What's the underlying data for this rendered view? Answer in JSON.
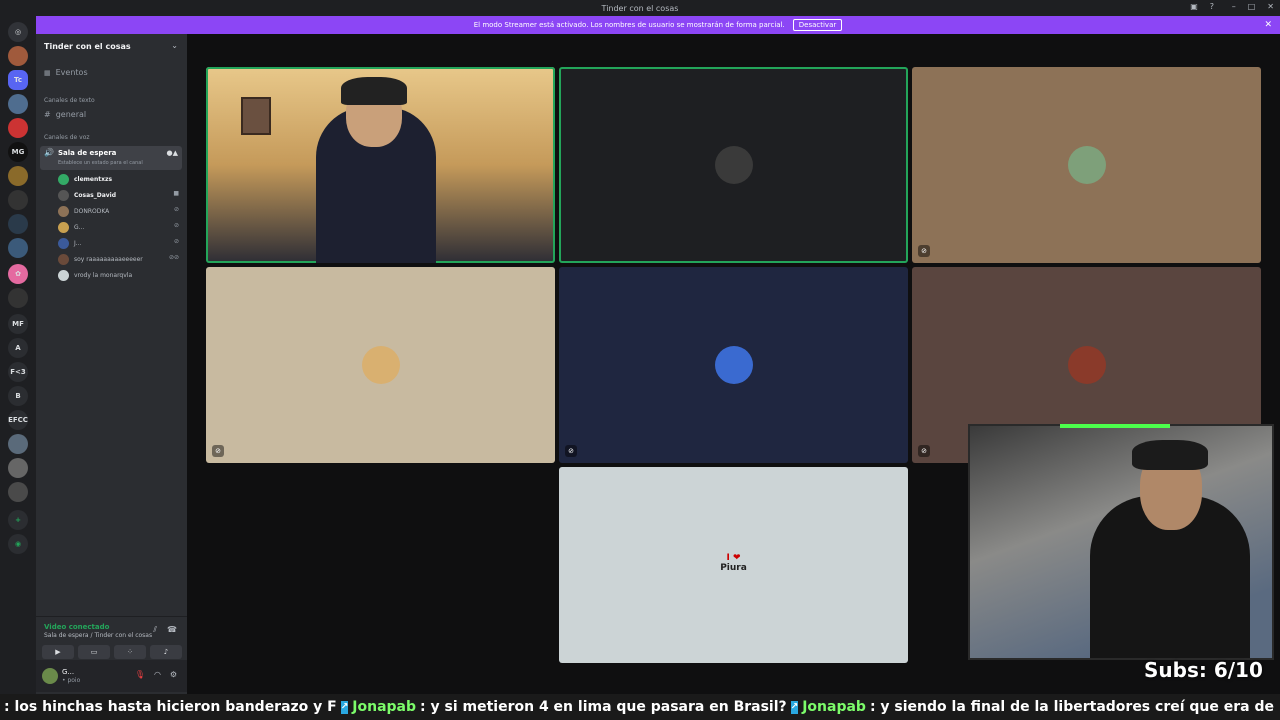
{
  "window": {
    "title": "Tinder con el cosas",
    "controls": [
      "–",
      "□",
      "✕"
    ]
  },
  "streamer_banner": {
    "text": "El modo Streamer está activado. Los nombres de usuario se mostrarán de forma parcial.",
    "button": "Desactivar",
    "close": "✕"
  },
  "guilds": [
    "MG",
    "MF",
    "A",
    "F<3",
    "B",
    "EFCC"
  ],
  "sidebar": {
    "server_name": "Tinder con el cosas",
    "events": "Eventos",
    "text_category": "Canales de texto",
    "text_channel": "general",
    "voice_category": "Canales de voz",
    "voice_channel": "Sala de espera",
    "voice_status": "Establece un estado para el canal",
    "users": [
      "clementxzs",
      "Cosas_David",
      "DONRODKA",
      "G...",
      "J...",
      "soy raaaaaaaaaeeeeer",
      "vrody la monarqvla"
    ]
  },
  "voice_panel": {
    "title": "Video conectado",
    "subtitle": "Sala de espera / Tinder con el cosas"
  },
  "user_panel": {
    "name": "G...",
    "status": "• poio"
  },
  "tiles": [
    {
      "color": "#2a2a2a",
      "label": "camera-feed"
    },
    {
      "color": "#1e1f22",
      "label": "avatar"
    },
    {
      "color": "#8d7257",
      "label": "avatar"
    },
    {
      "color": "#c8baa0",
      "label": "avatar"
    },
    {
      "color": "#1f2640",
      "label": "avatar"
    },
    {
      "color": "#5a453f",
      "label": "avatar"
    },
    {
      "color": "#ccd4d6",
      "label": "I ❤ Piura"
    }
  ],
  "piura": {
    "line1": "I ❤",
    "line2": "Piura"
  },
  "overlay": {
    "subs": "Subs: 6/10"
  },
  "ticker": {
    "part1": ": los hinchas hasta hicieron banderazo y F",
    "name1": "Jonapab",
    "part2": ": y si metieron 4 en lima que pasara en Brasil?",
    "name2": "Jonapab",
    "part3": ": y siendo la final de la libertadores creí que era de inspiración para la U"
  }
}
